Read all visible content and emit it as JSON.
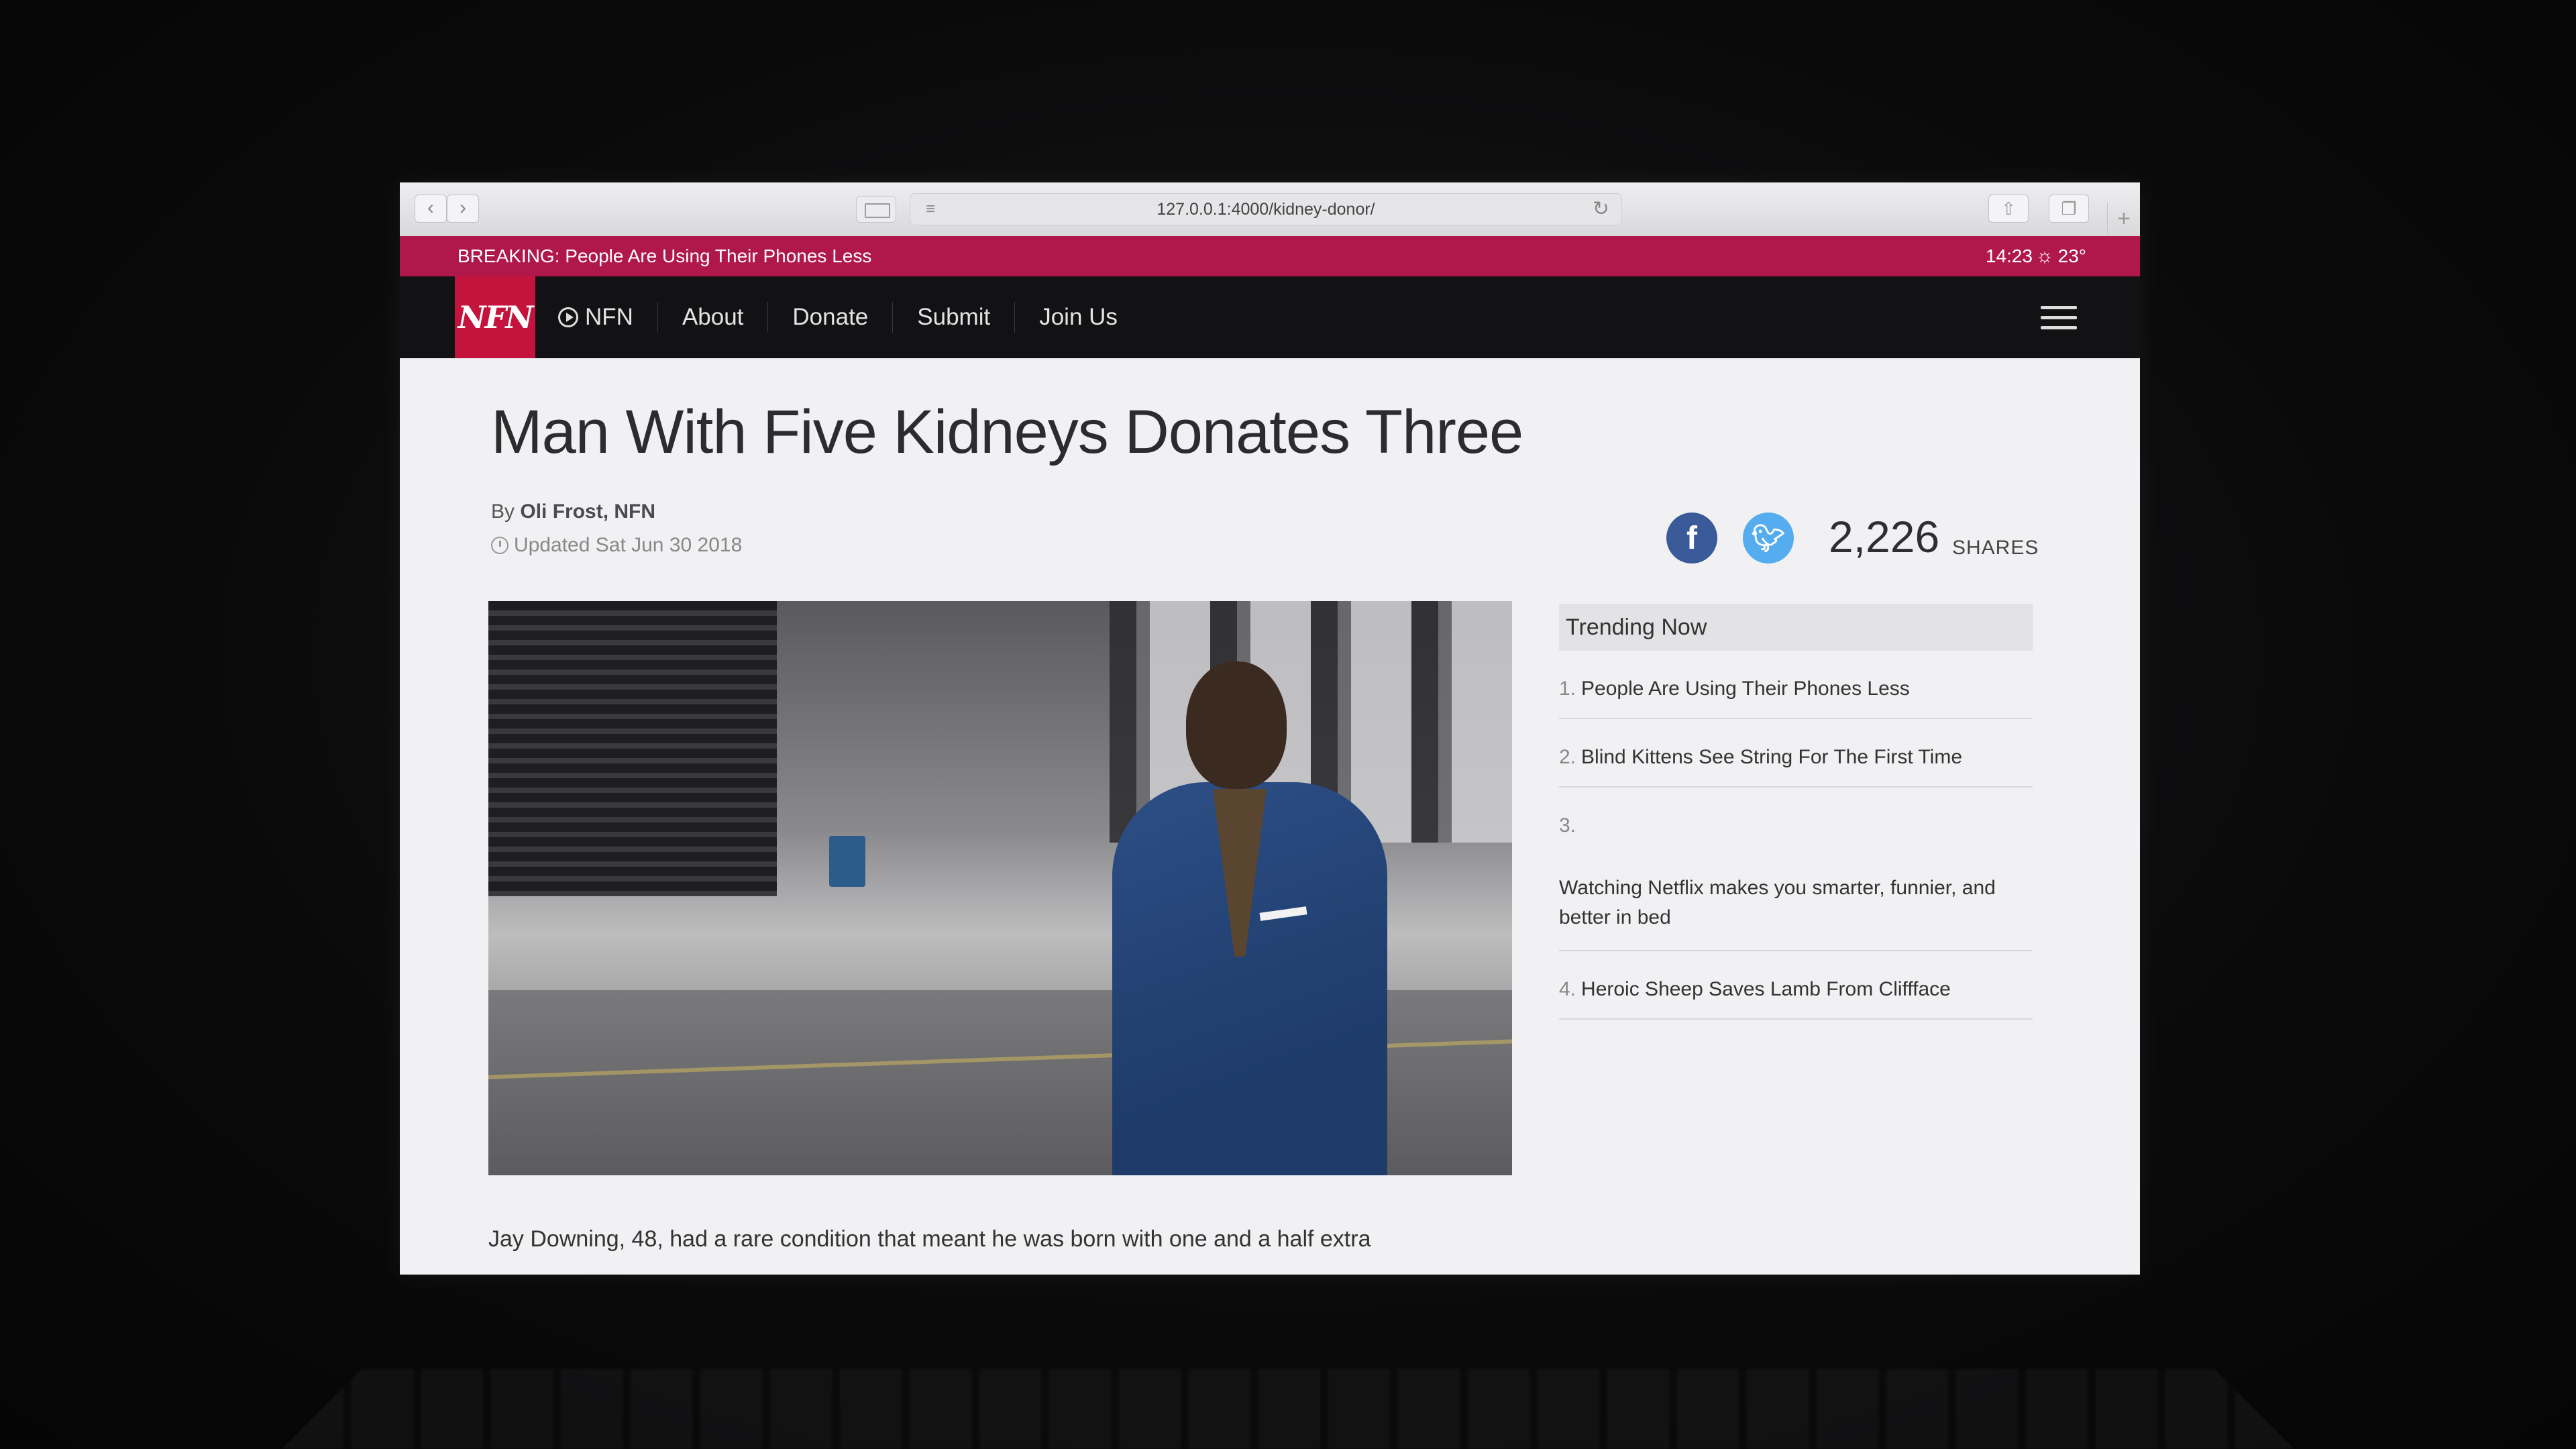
{
  "browser": {
    "url": "127.0.0.1:4000/kidney-donor/",
    "back_icon": "chevron-left",
    "forward_icon": "chevron-right",
    "reload_icon": "reload",
    "share_icon": "share",
    "tabs_icon": "tabs",
    "new_tab_icon": "plus"
  },
  "breaking": {
    "text": "BREAKING: People Are Using Their Phones Less",
    "time": "14:23",
    "weather": "23°"
  },
  "site_nav": {
    "logo": "NFN",
    "items": [
      "NFN",
      "About",
      "Donate",
      "Submit",
      "Join Us"
    ]
  },
  "article": {
    "headline": "Man With Five Kidneys Donates Three",
    "byline_prefix": "By",
    "byline_author": "Oli Frost, NFN",
    "updated": "Updated Sat Jun 30 2018",
    "share_count": "2,226",
    "share_label": "SHARES",
    "body_text": "Jay Downing, 48, had a rare condition that meant he was born with one and a half extra"
  },
  "trending": {
    "title": "Trending Now",
    "items": [
      {
        "num": "1.",
        "text": "People Are Using Their Phones Less"
      },
      {
        "num": "2.",
        "text": "Blind Kittens See String For The First Time"
      },
      {
        "num": "3.",
        "text": "Watching Netflix makes you smarter, funnier, and better in bed"
      },
      {
        "num": "4.",
        "text": "Heroic Sheep Saves Lamb From Cliffface"
      }
    ]
  },
  "colors": {
    "breaking_bar": "#b0184c",
    "logo_bg": "#c4143d",
    "facebook": "#3b5a9a",
    "twitter": "#55acee"
  }
}
